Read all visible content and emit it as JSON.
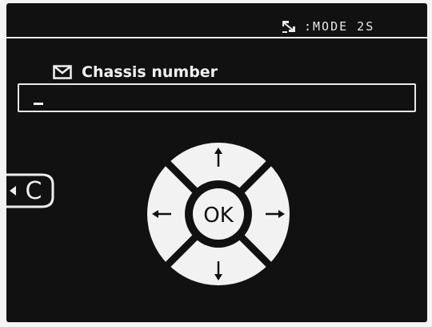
{
  "header": {
    "mode_icon": "mode-arrow-icon",
    "mode_label": ":MODE 2S"
  },
  "field": {
    "icon": "envelope-icon",
    "label": "Chassis number",
    "value": "",
    "cursor": "_"
  },
  "back_button": {
    "icon": "back-arrow-icon",
    "label": "C"
  },
  "dpad": {
    "ok_label": "OK",
    "up_icon": "arrow-up-icon",
    "down_icon": "arrow-down-icon",
    "left_icon": "arrow-left-icon",
    "right_icon": "arrow-right-icon"
  }
}
